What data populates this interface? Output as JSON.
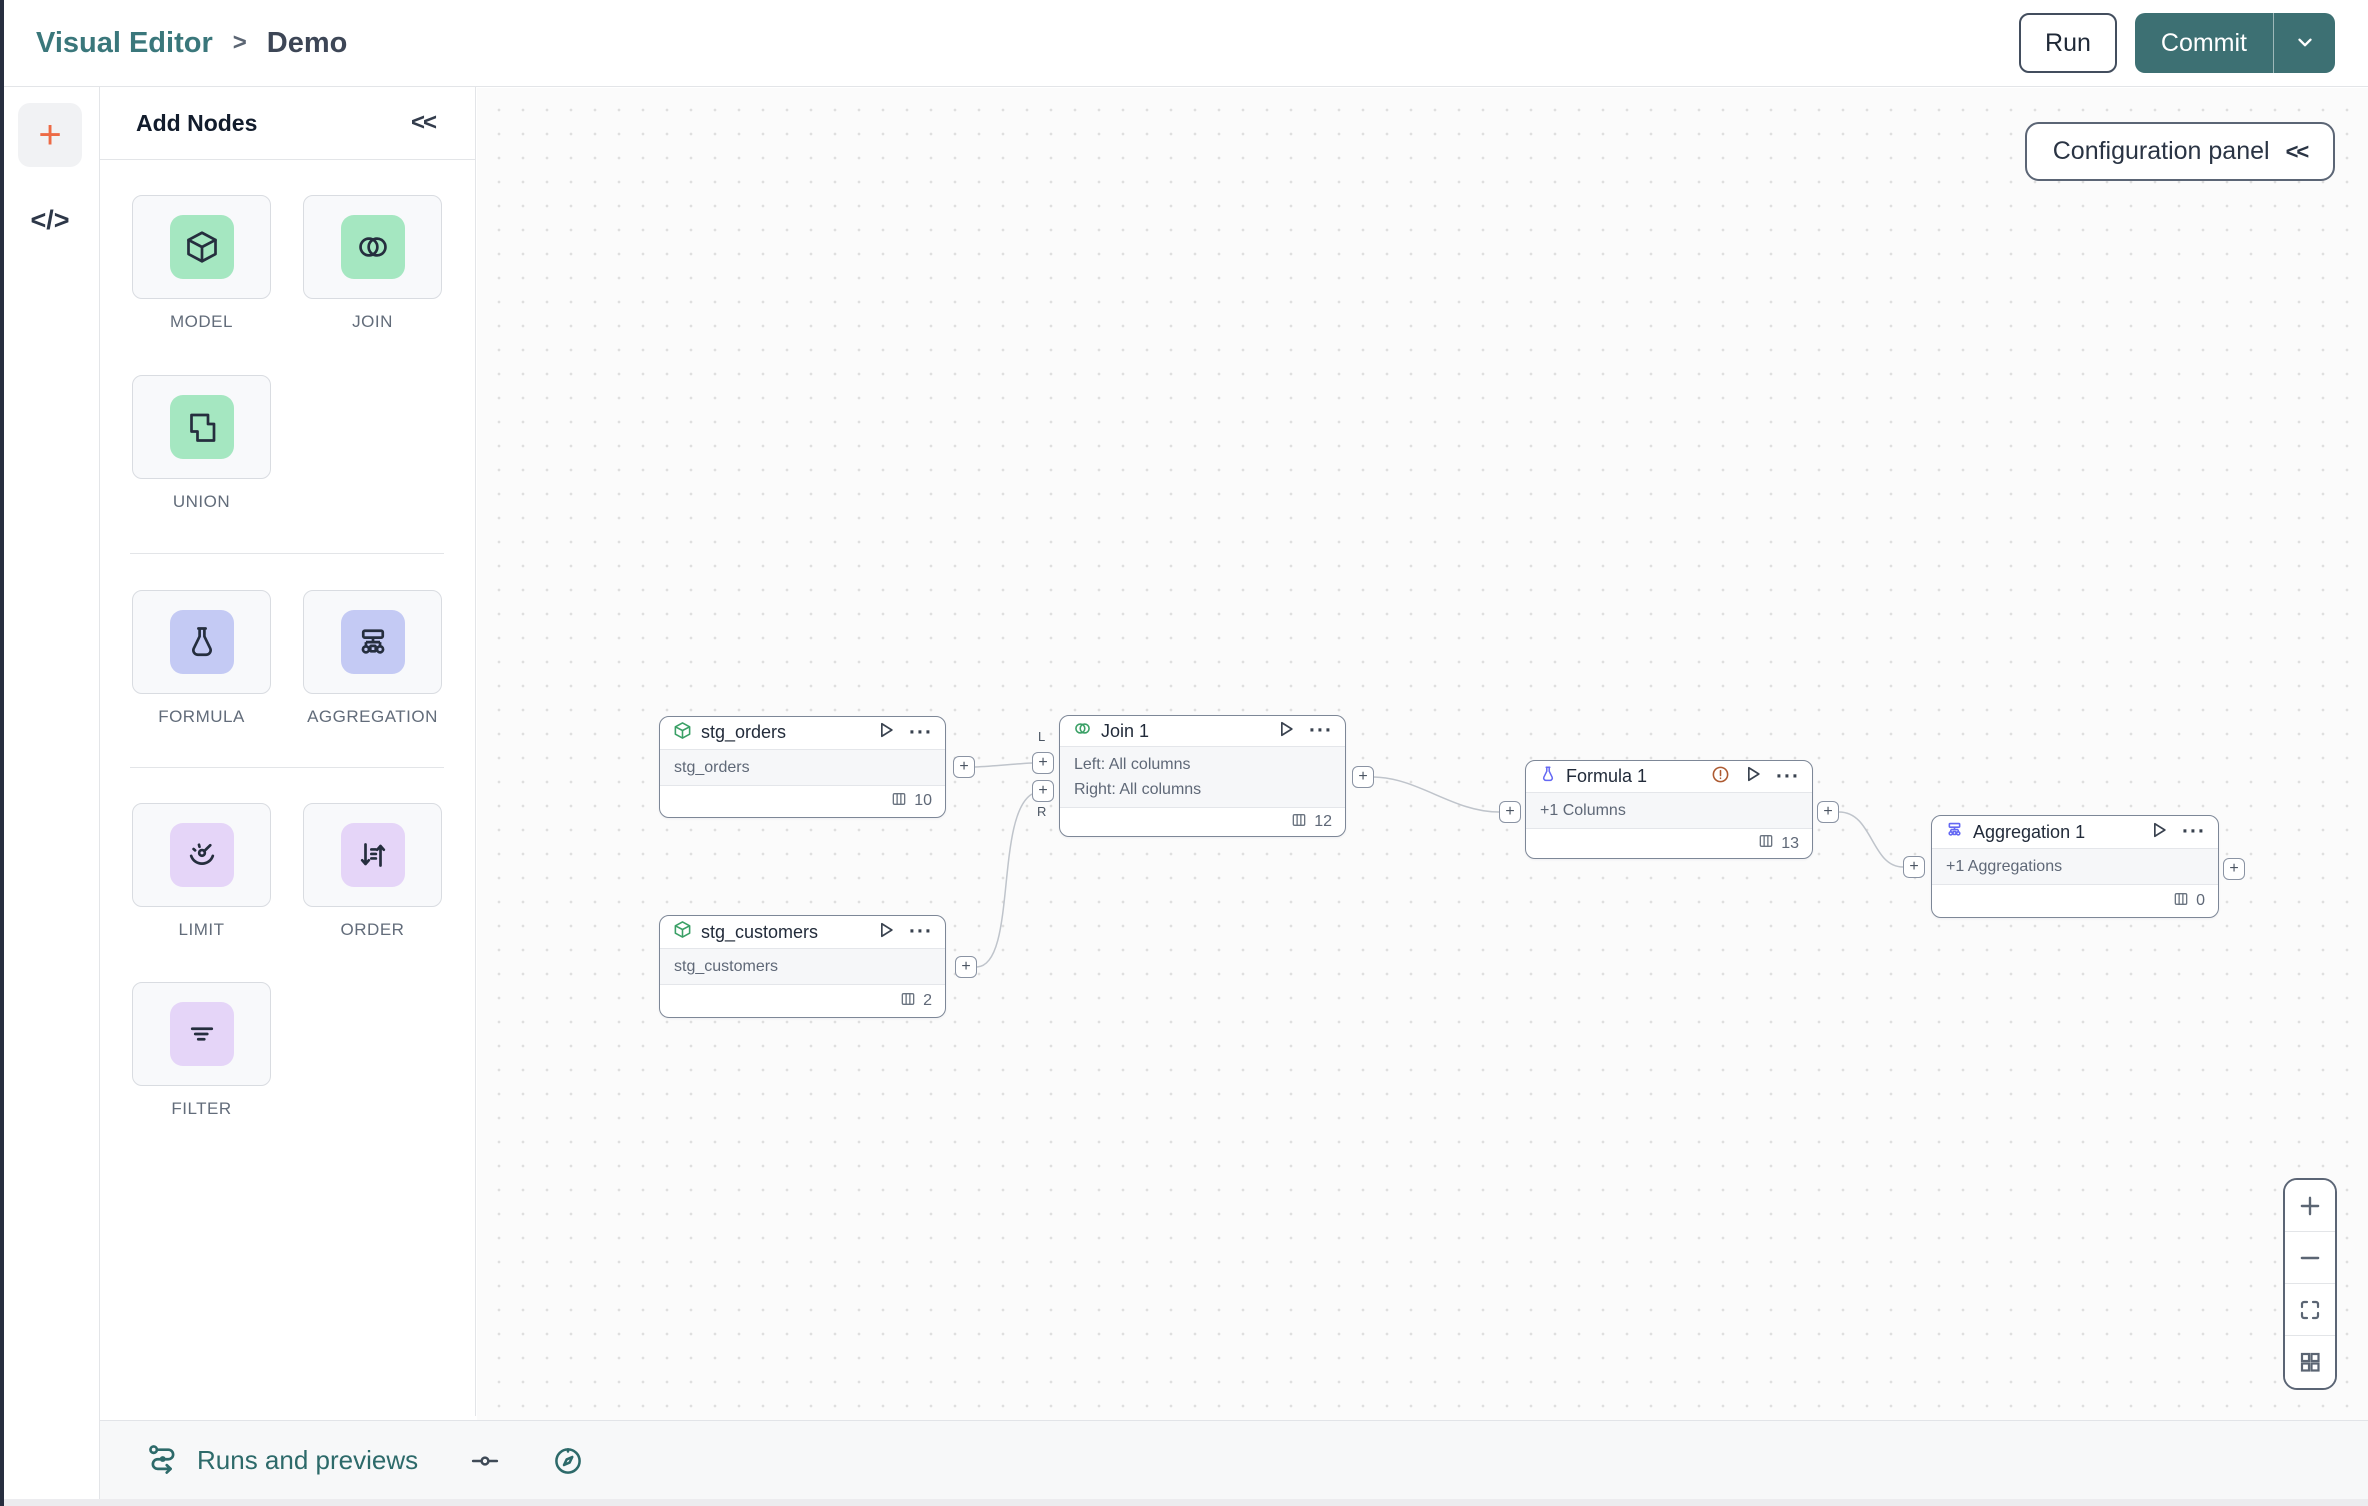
{
  "header": {
    "breadcrumb": {
      "app": "Visual Editor",
      "separator": ">",
      "page": "Demo"
    },
    "run_label": "Run",
    "commit_label": "Commit"
  },
  "rail": {
    "add_label": "+",
    "code_label": "</>"
  },
  "add_nodes_panel": {
    "title": "Add Nodes",
    "collapse_label": "<<",
    "groups": [
      {
        "tiles": [
          {
            "id": "model",
            "label": "MODEL"
          },
          {
            "id": "join",
            "label": "JOIN"
          },
          {
            "id": "union",
            "label": "UNION"
          }
        ]
      },
      {
        "tiles": [
          {
            "id": "formula",
            "label": "FORMULA"
          },
          {
            "id": "aggregation",
            "label": "AGGREGATION"
          }
        ]
      },
      {
        "tiles": [
          {
            "id": "limit",
            "label": "LIMIT"
          },
          {
            "id": "order",
            "label": "ORDER"
          },
          {
            "id": "filter",
            "label": "FILTER"
          }
        ]
      }
    ]
  },
  "canvas": {
    "config_panel_label": "Configuration panel",
    "config_collapse_label": "<<",
    "nodes": [
      {
        "title": "stg_orders",
        "body": [
          "stg_orders"
        ],
        "columns": "10"
      },
      {
        "title": "stg_customers",
        "body": [
          "stg_customers"
        ],
        "columns": "2"
      },
      {
        "title": "Join 1",
        "body": [
          "Left: All columns",
          "Right: All columns"
        ],
        "columns": "12"
      },
      {
        "title": "Formula 1",
        "body": [
          "+1 Columns"
        ],
        "columns": "13"
      },
      {
        "title": "Aggregation 1",
        "body": [
          "+1 Aggregations"
        ],
        "columns": "0"
      }
    ],
    "ports": {
      "plus": "+",
      "left_label": "L",
      "right_label": "R"
    }
  },
  "footer": {
    "runs_label": "Runs and previews"
  },
  "colors": {
    "brand_teal": "#3d7073",
    "breadcrumb_teal": "#3a777b",
    "footer_teal": "#2d6a6a",
    "node_green_icon": "#3aa066",
    "node_indigo_icon": "#6468f3",
    "warning_orange": "#ad5a31",
    "chip_green": "#a5e7c1",
    "chip_periwinkle": "#c4caf4",
    "chip_lilac": "#e5d5f8",
    "accent_plus_orange": "#ed6a45"
  }
}
